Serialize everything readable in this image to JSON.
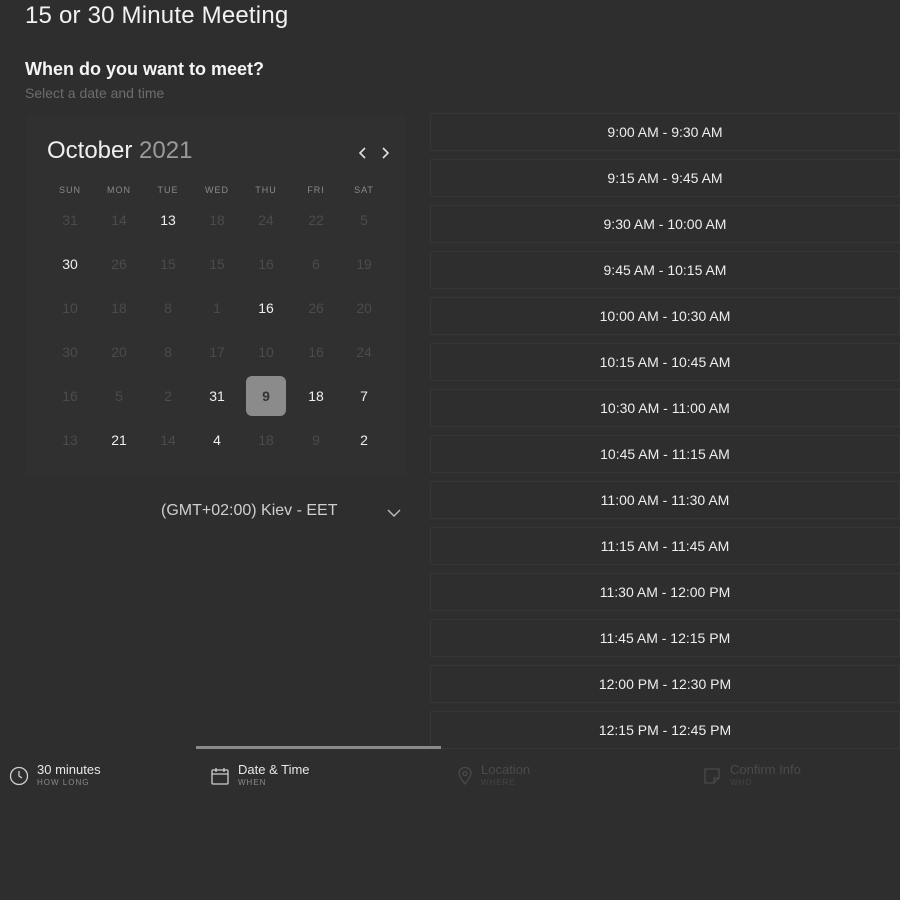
{
  "title": "15 or 30 Minute Meeting",
  "question": "When do you want to meet?",
  "question_sub": "Select a date and time",
  "calendar": {
    "month": "October",
    "year": "2021",
    "weekdays": [
      "SUN",
      "MON",
      "TUE",
      "WED",
      "THU",
      "FRI",
      "SAT"
    ],
    "weeks": [
      [
        {
          "d": "31",
          "a": false
        },
        {
          "d": "14",
          "a": false
        },
        {
          "d": "13",
          "a": true
        },
        {
          "d": "18",
          "a": false
        },
        {
          "d": "24",
          "a": false
        },
        {
          "d": "22",
          "a": false
        },
        {
          "d": "5",
          "a": false
        }
      ],
      [
        {
          "d": "30",
          "a": true
        },
        {
          "d": "26",
          "a": false
        },
        {
          "d": "15",
          "a": false
        },
        {
          "d": "15",
          "a": false
        },
        {
          "d": "16",
          "a": false
        },
        {
          "d": "6",
          "a": false
        },
        {
          "d": "19",
          "a": false
        }
      ],
      [
        {
          "d": "10",
          "a": false
        },
        {
          "d": "18",
          "a": false
        },
        {
          "d": "8",
          "a": false
        },
        {
          "d": "1",
          "a": false
        },
        {
          "d": "16",
          "a": true
        },
        {
          "d": "26",
          "a": false
        },
        {
          "d": "20",
          "a": false
        }
      ],
      [
        {
          "d": "30",
          "a": false
        },
        {
          "d": "20",
          "a": false
        },
        {
          "d": "8",
          "a": false
        },
        {
          "d": "17",
          "a": false
        },
        {
          "d": "10",
          "a": false
        },
        {
          "d": "16",
          "a": false
        },
        {
          "d": "24",
          "a": false
        }
      ],
      [
        {
          "d": "16",
          "a": false
        },
        {
          "d": "5",
          "a": false
        },
        {
          "d": "2",
          "a": false
        },
        {
          "d": "31",
          "a": true
        },
        {
          "d": "9",
          "a": true,
          "selected": true
        },
        {
          "d": "18",
          "a": true
        },
        {
          "d": "7",
          "a": true
        }
      ],
      [
        {
          "d": "13",
          "a": false
        },
        {
          "d": "21",
          "a": true
        },
        {
          "d": "14",
          "a": false
        },
        {
          "d": "4",
          "a": true
        },
        {
          "d": "18",
          "a": false
        },
        {
          "d": "9",
          "a": false
        },
        {
          "d": "2",
          "a": true
        }
      ]
    ]
  },
  "timezone": "(GMT+02:00) Kiev - EET",
  "slots": [
    "9:00 AM - 9:30 AM",
    "9:15 AM - 9:45 AM",
    "9:30 AM - 10:00 AM",
    "9:45 AM - 10:15 AM",
    "10:00 AM - 10:30 AM",
    "10:15 AM - 10:45 AM",
    "10:30 AM - 11:00 AM",
    "10:45 AM - 11:15 AM",
    "11:00 AM - 11:30 AM",
    "11:15 AM - 11:45 AM",
    "11:30 AM - 12:00 PM",
    "11:45 AM - 12:15 PM",
    "12:00 PM - 12:30 PM",
    "12:15 PM - 12:45 PM"
  ],
  "steps": [
    {
      "label": "30 minutes",
      "sub": "HOW LONG",
      "icon": "clock-icon",
      "active": true
    },
    {
      "label": "Date & Time",
      "sub": "WHEN",
      "icon": "calendar-icon",
      "active": true
    },
    {
      "label": "Location",
      "sub": "WHERE",
      "icon": "map-pin-icon",
      "active": false
    },
    {
      "label": "Confirm Info",
      "sub": "WHO",
      "icon": "note-icon",
      "active": false
    }
  ],
  "colors": {
    "background": "#2e2e2e",
    "selected_day": "#8b8b8b",
    "slot_border": "#363636"
  }
}
